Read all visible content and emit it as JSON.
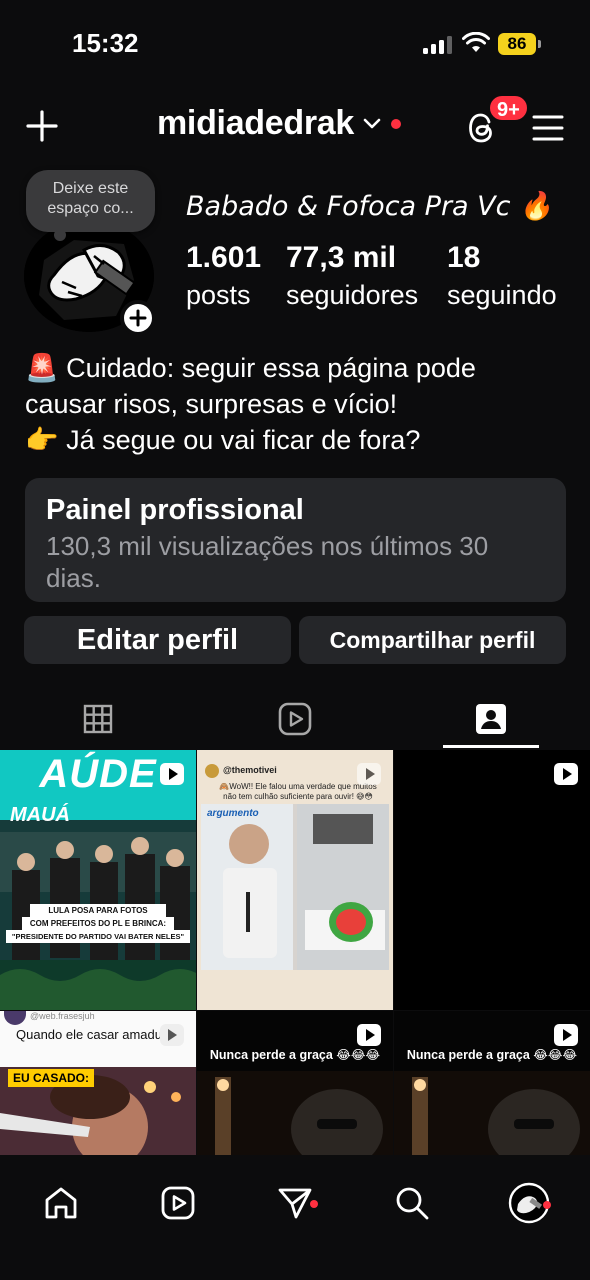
{
  "status_bar": {
    "time": "15:32",
    "battery": "86"
  },
  "header": {
    "username": "midiadedrak",
    "threads_badge": "9+"
  },
  "profile": {
    "note_placeholder": "Deixe este espaço co...",
    "name": "Babado & Fofoca Pra Vc 🔥",
    "stats": [
      {
        "value": "1.601",
        "label": "posts"
      },
      {
        "value": "77,3 mil",
        "label": "seguidores"
      },
      {
        "value": "18",
        "label": "seguindo"
      }
    ],
    "bio_lines": [
      "🚨 Cuidado: seguir essa página pode",
      "causar risos, surpresas e vício!",
      "👉 Já segue ou vai ficar de fora?"
    ]
  },
  "panel": {
    "title": "Painel profissional",
    "subtitle": "130,3 mil visualizações nos últimos 30 dias."
  },
  "buttons": {
    "edit": "Editar perfil",
    "share": "Compartilhar perfil"
  },
  "tabs": [
    {
      "icon": "grid-icon",
      "active": false
    },
    {
      "icon": "reels-icon",
      "active": false
    },
    {
      "icon": "tagged-icon",
      "active": true
    }
  ],
  "posts": [
    {
      "banner_top": "AÚDE",
      "banner_sub": "MAUÁ",
      "caption_line1": "LULA POSA PARA FOTOS",
      "caption_line2": "COM PREFEITOS DO PL E BRINCA:",
      "caption_line3": "\"PRESIDENTE DO PARTIDO VAI BATER NELES\""
    },
    {
      "handle": "@themotivei",
      "text": "🙈WoW!! Ele falou uma verdade que muitos não tem culhão suficiente para ouvir! 😅😳",
      "brand": "argumento"
    },
    {
      "type": "reel-dark"
    },
    {
      "handle": "@web.frasesjuh",
      "text": "Quando ele casar amadure",
      "label": "EU CASADO:"
    },
    {
      "text": "Nunca perde a graça 😂😂😂"
    },
    {
      "text": "Nunca perde a graça 😂😂😂"
    }
  ],
  "colors": {
    "background": "#0c0c0d",
    "card": "#252629",
    "accent_red": "#ff3040",
    "battery": "#f5d21d"
  }
}
